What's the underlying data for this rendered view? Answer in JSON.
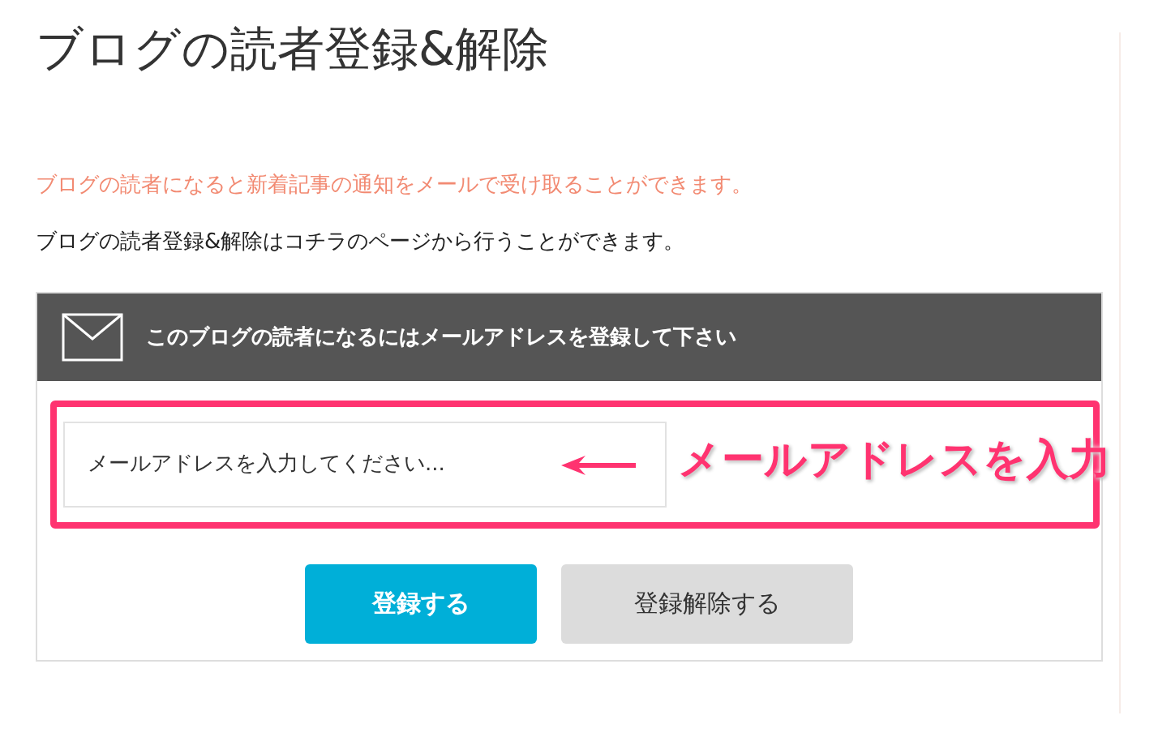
{
  "page_title": "ブログの読者登録&解除",
  "notice": "ブログの読者になると新着記事の通知をメールで受け取ることができます。",
  "description": "ブログの読者登録&解除はコチラのページから行うことができます。",
  "subscribe_form": {
    "header": "このブログの読者になるにはメールアドレスを登録して下さい",
    "email_field": {
      "placeholder": "メールアドレスを入力してください..."
    },
    "buttons": [
      {
        "label": "登録する",
        "kind": "primary"
      },
      {
        "label": "登録解除する",
        "kind": "secondary"
      }
    ]
  },
  "annotation": {
    "label": "メールアドレスを入力"
  }
}
